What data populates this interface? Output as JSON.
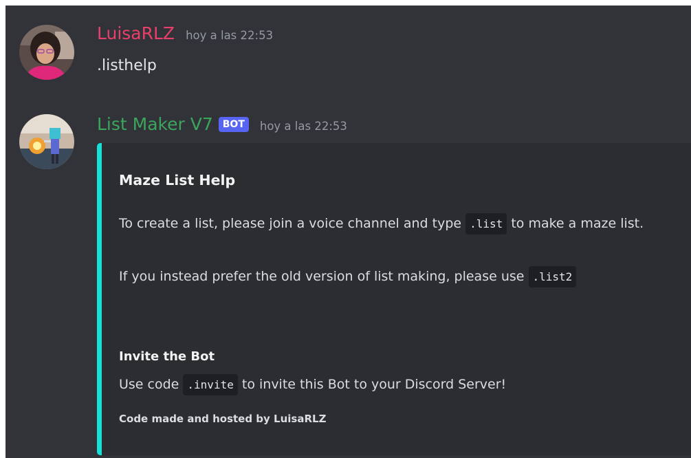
{
  "messages": [
    {
      "username": "LuisaRLZ",
      "timestamp": "hoy a las 22:53",
      "content": ".listhelp"
    },
    {
      "username": "List Maker V7",
      "badge": "BOT",
      "timestamp": "hoy a las 22:53",
      "embed": {
        "accent_color": "#16e0d8",
        "title": "Maze List Help",
        "desc_p1_a": "To create a list, please join a voice channel and type ",
        "desc_p1_code": ".list",
        "desc_p1_b": " to make a maze list.",
        "desc_p2_a": "If you instead prefer the old version of list making, please use ",
        "desc_p2_code": ".list2",
        "field_name": "Invite the Bot",
        "field_a": "Use code ",
        "field_code": ".invite",
        "field_b": " to invite this Bot to your Discord Server!",
        "footer": "Code made and hosted by LuisaRLZ"
      }
    }
  ],
  "colors": {
    "background": "#313338",
    "embed_background": "#2b2d31",
    "user1_name": "#e8406b",
    "bot_name": "#3ba55c",
    "bot_badge": "#5865f2",
    "timestamp": "#949ba4"
  }
}
